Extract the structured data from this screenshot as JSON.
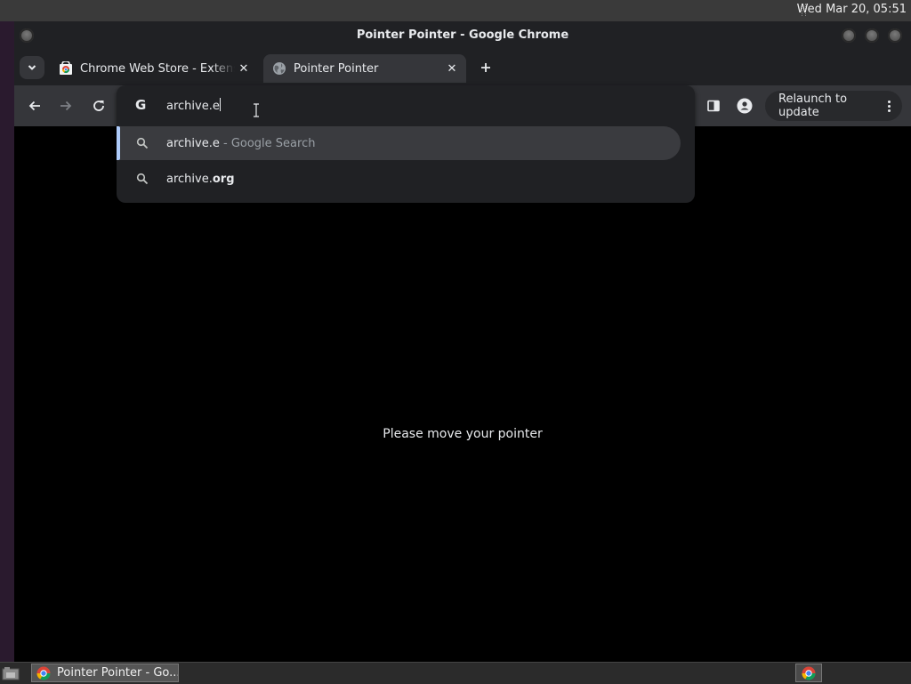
{
  "system": {
    "clock": "Wed Mar 20, 05:51"
  },
  "window": {
    "title": "Pointer Pointer - Google Chrome"
  },
  "tabs": [
    {
      "label": "Chrome Web Store - Extensions",
      "icon": "chrome-web-store-icon"
    },
    {
      "label": "Pointer Pointer",
      "icon": "globe-icon",
      "active": true
    }
  ],
  "toolbar": {
    "relaunch_label": "Relaunch to update"
  },
  "omnibox": {
    "value": "archive.e",
    "suggestions": [
      {
        "main": "archive.e",
        "suffix": " - Google Search",
        "selected": true
      },
      {
        "main": "archive.",
        "bold": "org"
      }
    ]
  },
  "page": {
    "message": "Please move your pointer"
  },
  "taskbar": {
    "task_label": "Pointer Pointer - Go..."
  },
  "colors": {
    "accent": "#aecbfa",
    "toolbar": "#35363a",
    "frame": "#202124"
  }
}
